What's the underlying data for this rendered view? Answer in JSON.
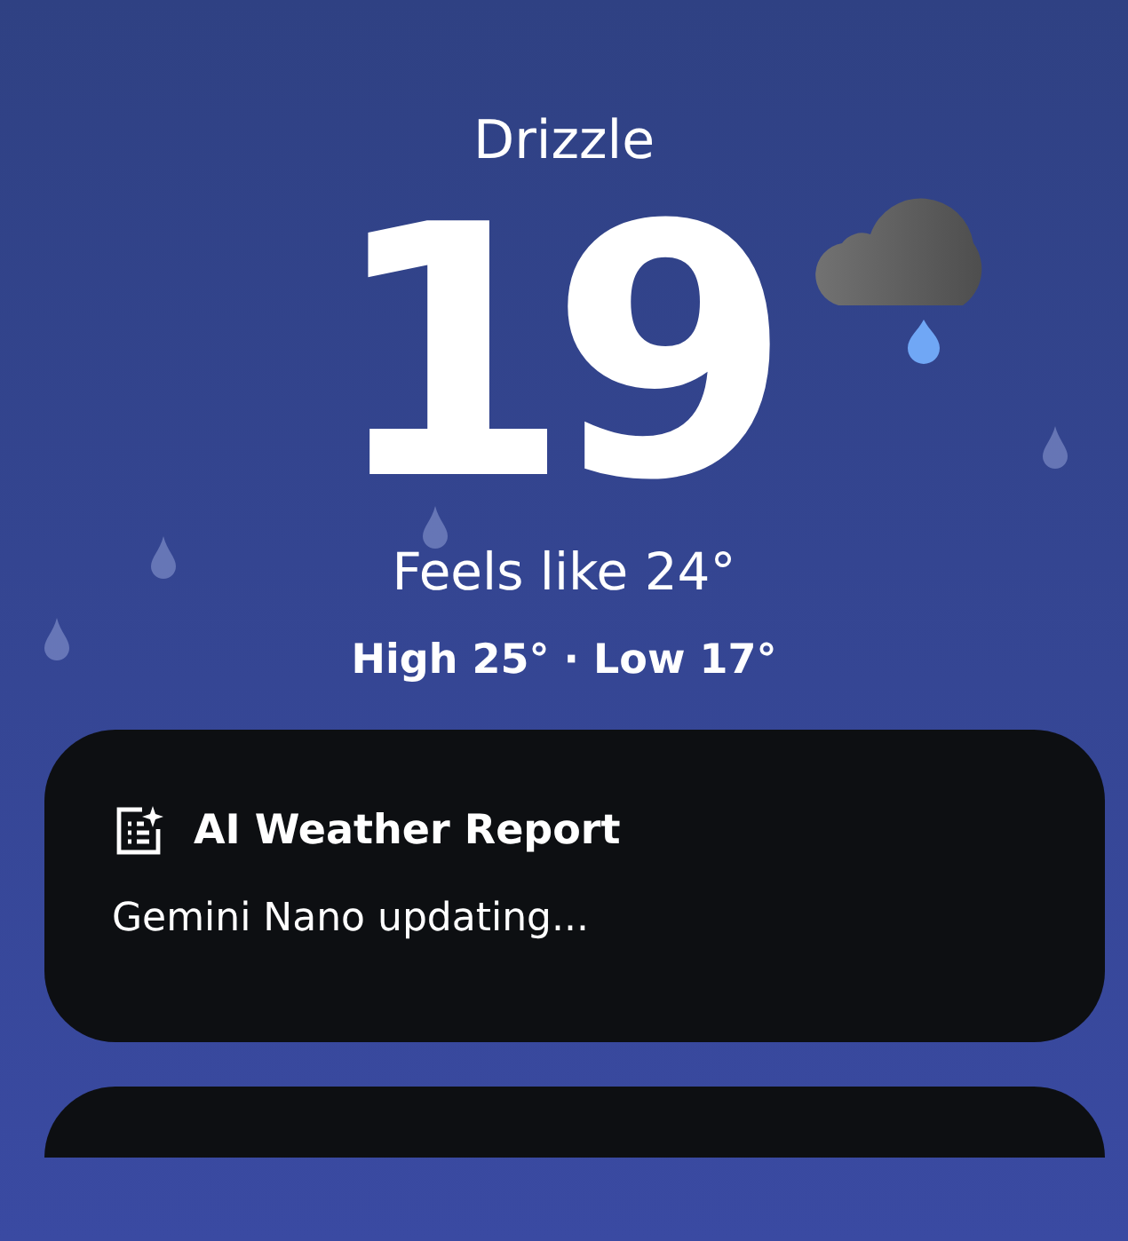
{
  "condition": "Drizzle",
  "temperature": "19",
  "feels_like": "Feels like 24°",
  "high_low": "High 25° · Low 17°",
  "report_card": {
    "title": "AI Weather Report",
    "status": "Gemini Nano updating..."
  }
}
